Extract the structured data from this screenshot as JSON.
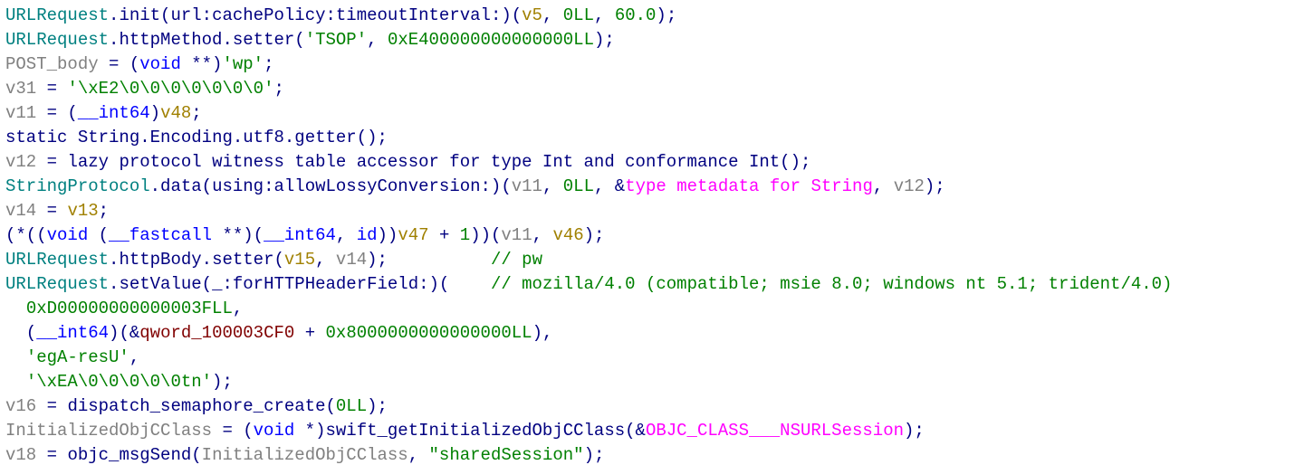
{
  "code": {
    "lines": [
      {
        "segs": [
          {
            "t": "URLRequest",
            "c": "t-teal"
          },
          {
            "t": ".",
            "c": "t-navy"
          },
          {
            "t": "init",
            "c": "t-navy"
          },
          {
            "t": "(",
            "c": "t-navy"
          },
          {
            "t": "url",
            "c": "t-navy"
          },
          {
            "t": ":",
            "c": "t-navy"
          },
          {
            "t": "cachePolicy",
            "c": "t-navy"
          },
          {
            "t": ":",
            "c": "t-navy"
          },
          {
            "t": "timeoutInterval",
            "c": "t-navy"
          },
          {
            "t": ":)(",
            "c": "t-navy"
          },
          {
            "t": "v5",
            "c": "t-orange"
          },
          {
            "t": ", ",
            "c": "t-navy"
          },
          {
            "t": "0LL",
            "c": "t-green"
          },
          {
            "t": ", ",
            "c": "t-navy"
          },
          {
            "t": "60.0",
            "c": "t-green"
          },
          {
            "t": ");",
            "c": "t-navy"
          }
        ]
      },
      {
        "segs": [
          {
            "t": "URLRequest",
            "c": "t-teal"
          },
          {
            "t": ".",
            "c": "t-navy"
          },
          {
            "t": "httpMethod",
            "c": "t-navy"
          },
          {
            "t": ".",
            "c": "t-navy"
          },
          {
            "t": "setter",
            "c": "t-navy"
          },
          {
            "t": "(",
            "c": "t-navy"
          },
          {
            "t": "'TSOP'",
            "c": "t-green"
          },
          {
            "t": ", ",
            "c": "t-navy"
          },
          {
            "t": "0xE400000000000000LL",
            "c": "t-green"
          },
          {
            "t": ");",
            "c": "t-navy"
          }
        ]
      },
      {
        "segs": [
          {
            "t": "POST_body",
            "c": "t-gray"
          },
          {
            "t": " = (",
            "c": "t-navy"
          },
          {
            "t": "void",
            "c": "t-blue"
          },
          {
            "t": " **)",
            "c": "t-navy"
          },
          {
            "t": "'wp'",
            "c": "t-green"
          },
          {
            "t": ";",
            "c": "t-navy"
          }
        ]
      },
      {
        "segs": [
          {
            "t": "v31",
            "c": "t-gray"
          },
          {
            "t": " = ",
            "c": "t-navy"
          },
          {
            "t": "'\\xE2\\0\\0\\0\\0\\0\\0\\0'",
            "c": "t-green"
          },
          {
            "t": ";",
            "c": "t-navy"
          }
        ]
      },
      {
        "segs": [
          {
            "t": "v11",
            "c": "t-gray"
          },
          {
            "t": " = (",
            "c": "t-navy"
          },
          {
            "t": "__int64",
            "c": "t-blue"
          },
          {
            "t": ")",
            "c": "t-navy"
          },
          {
            "t": "v48",
            "c": "t-orange"
          },
          {
            "t": ";",
            "c": "t-navy"
          }
        ]
      },
      {
        "segs": [
          {
            "t": "static",
            "c": "t-navy"
          },
          {
            "t": " ",
            "c": "t-navy"
          },
          {
            "t": "String",
            "c": "t-navy"
          },
          {
            "t": ".",
            "c": "t-navy"
          },
          {
            "t": "Encoding",
            "c": "t-navy"
          },
          {
            "t": ".",
            "c": "t-navy"
          },
          {
            "t": "utf8",
            "c": "t-navy"
          },
          {
            "t": ".",
            "c": "t-navy"
          },
          {
            "t": "getter",
            "c": "t-navy"
          },
          {
            "t": "();",
            "c": "t-navy"
          }
        ]
      },
      {
        "segs": [
          {
            "t": "v12",
            "c": "t-gray"
          },
          {
            "t": " = ",
            "c": "t-navy"
          },
          {
            "t": "lazy protocol witness table accessor for type Int and conformance Int",
            "c": "t-navy"
          },
          {
            "t": "();",
            "c": "t-navy"
          }
        ]
      },
      {
        "segs": [
          {
            "t": "StringProtocol",
            "c": "t-teal"
          },
          {
            "t": ".",
            "c": "t-navy"
          },
          {
            "t": "data",
            "c": "t-navy"
          },
          {
            "t": "(",
            "c": "t-navy"
          },
          {
            "t": "using",
            "c": "t-navy"
          },
          {
            "t": ":",
            "c": "t-navy"
          },
          {
            "t": "allowLossyConversion",
            "c": "t-navy"
          },
          {
            "t": ":)(",
            "c": "t-navy"
          },
          {
            "t": "v11",
            "c": "t-gray"
          },
          {
            "t": ", ",
            "c": "t-navy"
          },
          {
            "t": "0LL",
            "c": "t-green"
          },
          {
            "t": ", &",
            "c": "t-navy"
          },
          {
            "t": "type metadata for String",
            "c": "t-mag"
          },
          {
            "t": ", ",
            "c": "t-navy"
          },
          {
            "t": "v12",
            "c": "t-gray"
          },
          {
            "t": ");",
            "c": "t-navy"
          }
        ]
      },
      {
        "segs": [
          {
            "t": "v14",
            "c": "t-gray"
          },
          {
            "t": " = ",
            "c": "t-navy"
          },
          {
            "t": "v13",
            "c": "t-orange"
          },
          {
            "t": ";",
            "c": "t-navy"
          }
        ]
      },
      {
        "segs": [
          {
            "t": "(*((",
            "c": "t-navy"
          },
          {
            "t": "void",
            "c": "t-blue"
          },
          {
            "t": " (",
            "c": "t-navy"
          },
          {
            "t": "__fastcall",
            "c": "t-blue"
          },
          {
            "t": " **)(",
            "c": "t-navy"
          },
          {
            "t": "__int64",
            "c": "t-blue"
          },
          {
            "t": ", ",
            "c": "t-navy"
          },
          {
            "t": "id",
            "c": "t-blue"
          },
          {
            "t": "))",
            "c": "t-navy"
          },
          {
            "t": "v47",
            "c": "t-orange"
          },
          {
            "t": " + ",
            "c": "t-navy"
          },
          {
            "t": "1",
            "c": "t-green"
          },
          {
            "t": "))(",
            "c": "t-navy"
          },
          {
            "t": "v11",
            "c": "t-gray"
          },
          {
            "t": ", ",
            "c": "t-navy"
          },
          {
            "t": "v46",
            "c": "t-orange"
          },
          {
            "t": ");",
            "c": "t-navy"
          }
        ]
      },
      {
        "segs": [
          {
            "t": "URLRequest",
            "c": "t-teal"
          },
          {
            "t": ".",
            "c": "t-navy"
          },
          {
            "t": "httpBody",
            "c": "t-navy"
          },
          {
            "t": ".",
            "c": "t-navy"
          },
          {
            "t": "setter",
            "c": "t-navy"
          },
          {
            "t": "(",
            "c": "t-navy"
          },
          {
            "t": "v15",
            "c": "t-orange"
          },
          {
            "t": ", ",
            "c": "t-navy"
          },
          {
            "t": "v14",
            "c": "t-gray"
          },
          {
            "t": ");          ",
            "c": "t-navy"
          },
          {
            "t": "// pw",
            "c": "t-green"
          }
        ]
      },
      {
        "segs": [
          {
            "t": "URLRequest",
            "c": "t-teal"
          },
          {
            "t": ".",
            "c": "t-navy"
          },
          {
            "t": "setValue",
            "c": "t-navy"
          },
          {
            "t": "(",
            "c": "t-navy"
          },
          {
            "t": "_",
            "c": "t-navy"
          },
          {
            "t": ":",
            "c": "t-navy"
          },
          {
            "t": "forHTTPHeaderField",
            "c": "t-navy"
          },
          {
            "t": ":)(    ",
            "c": "t-navy"
          },
          {
            "t": "// mozilla/4.0 (compatible; msie 8.0; windows nt 5.1; trident/4.0)",
            "c": "t-green"
          }
        ]
      },
      {
        "segs": [
          {
            "t": "  ",
            "c": "t-navy"
          },
          {
            "t": "0xD00000000000003FLL",
            "c": "t-green"
          },
          {
            "t": ",",
            "c": "t-navy"
          }
        ]
      },
      {
        "segs": [
          {
            "t": "  (",
            "c": "t-navy"
          },
          {
            "t": "__int64",
            "c": "t-blue"
          },
          {
            "t": ")(&",
            "c": "t-navy"
          },
          {
            "t": "qword_100003CF0",
            "c": "t-brown"
          },
          {
            "t": " + ",
            "c": "t-navy"
          },
          {
            "t": "0x8000000000000000LL",
            "c": "t-green"
          },
          {
            "t": "),",
            "c": "t-navy"
          }
        ]
      },
      {
        "segs": [
          {
            "t": "  ",
            "c": "t-navy"
          },
          {
            "t": "'egA-resU'",
            "c": "t-green"
          },
          {
            "t": ",",
            "c": "t-navy"
          }
        ]
      },
      {
        "segs": [
          {
            "t": "  ",
            "c": "t-navy"
          },
          {
            "t": "'\\xEA\\0\\0\\0\\0\\0tn'",
            "c": "t-green"
          },
          {
            "t": ");",
            "c": "t-navy"
          }
        ]
      },
      {
        "segs": [
          {
            "t": "v16",
            "c": "t-gray"
          },
          {
            "t": " = ",
            "c": "t-navy"
          },
          {
            "t": "dispatch_semaphore_create",
            "c": "t-navy"
          },
          {
            "t": "(",
            "c": "t-navy"
          },
          {
            "t": "0LL",
            "c": "t-green"
          },
          {
            "t": ");",
            "c": "t-navy"
          }
        ]
      },
      {
        "segs": [
          {
            "t": "InitializedObjCClass",
            "c": "t-gray"
          },
          {
            "t": " = (",
            "c": "t-navy"
          },
          {
            "t": "void",
            "c": "t-blue"
          },
          {
            "t": " *)",
            "c": "t-navy"
          },
          {
            "t": "swift_getInitializedObjCClass",
            "c": "t-navy"
          },
          {
            "t": "(&",
            "c": "t-navy"
          },
          {
            "t": "OBJC_CLASS___NSURLSession",
            "c": "t-mag"
          },
          {
            "t": ");",
            "c": "t-navy"
          }
        ]
      },
      {
        "segs": [
          {
            "t": "v18",
            "c": "t-gray"
          },
          {
            "t": " = ",
            "c": "t-navy"
          },
          {
            "t": "objc_msgSend",
            "c": "t-navy"
          },
          {
            "t": "(",
            "c": "t-navy"
          },
          {
            "t": "InitializedObjCClass",
            "c": "t-gray"
          },
          {
            "t": ", ",
            "c": "t-navy"
          },
          {
            "t": "\"sharedSession\"",
            "c": "t-green"
          },
          {
            "t": ");",
            "c": "t-navy"
          }
        ]
      }
    ]
  }
}
